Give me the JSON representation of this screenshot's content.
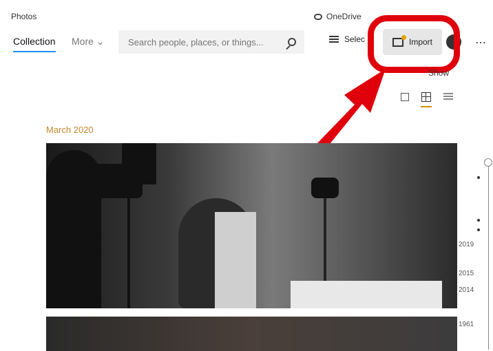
{
  "app": {
    "title": "Photos"
  },
  "onedrive": {
    "label": "OneDrive"
  },
  "nav": {
    "collection": "Collection",
    "more": "More ⌄"
  },
  "search": {
    "placeholder": "Search people, places, or things..."
  },
  "toolbar": {
    "select_label": "Selec",
    "import_label": "Import",
    "more_icon": "⋯"
  },
  "slideshow": {
    "label": "Show"
  },
  "gallery": {
    "month": "March 2020"
  },
  "timeline": {
    "years": [
      "2019",
      "2015",
      "2014",
      "1961"
    ]
  },
  "colors": {
    "highlight": "#e0000b",
    "accent": "#d28a00"
  }
}
